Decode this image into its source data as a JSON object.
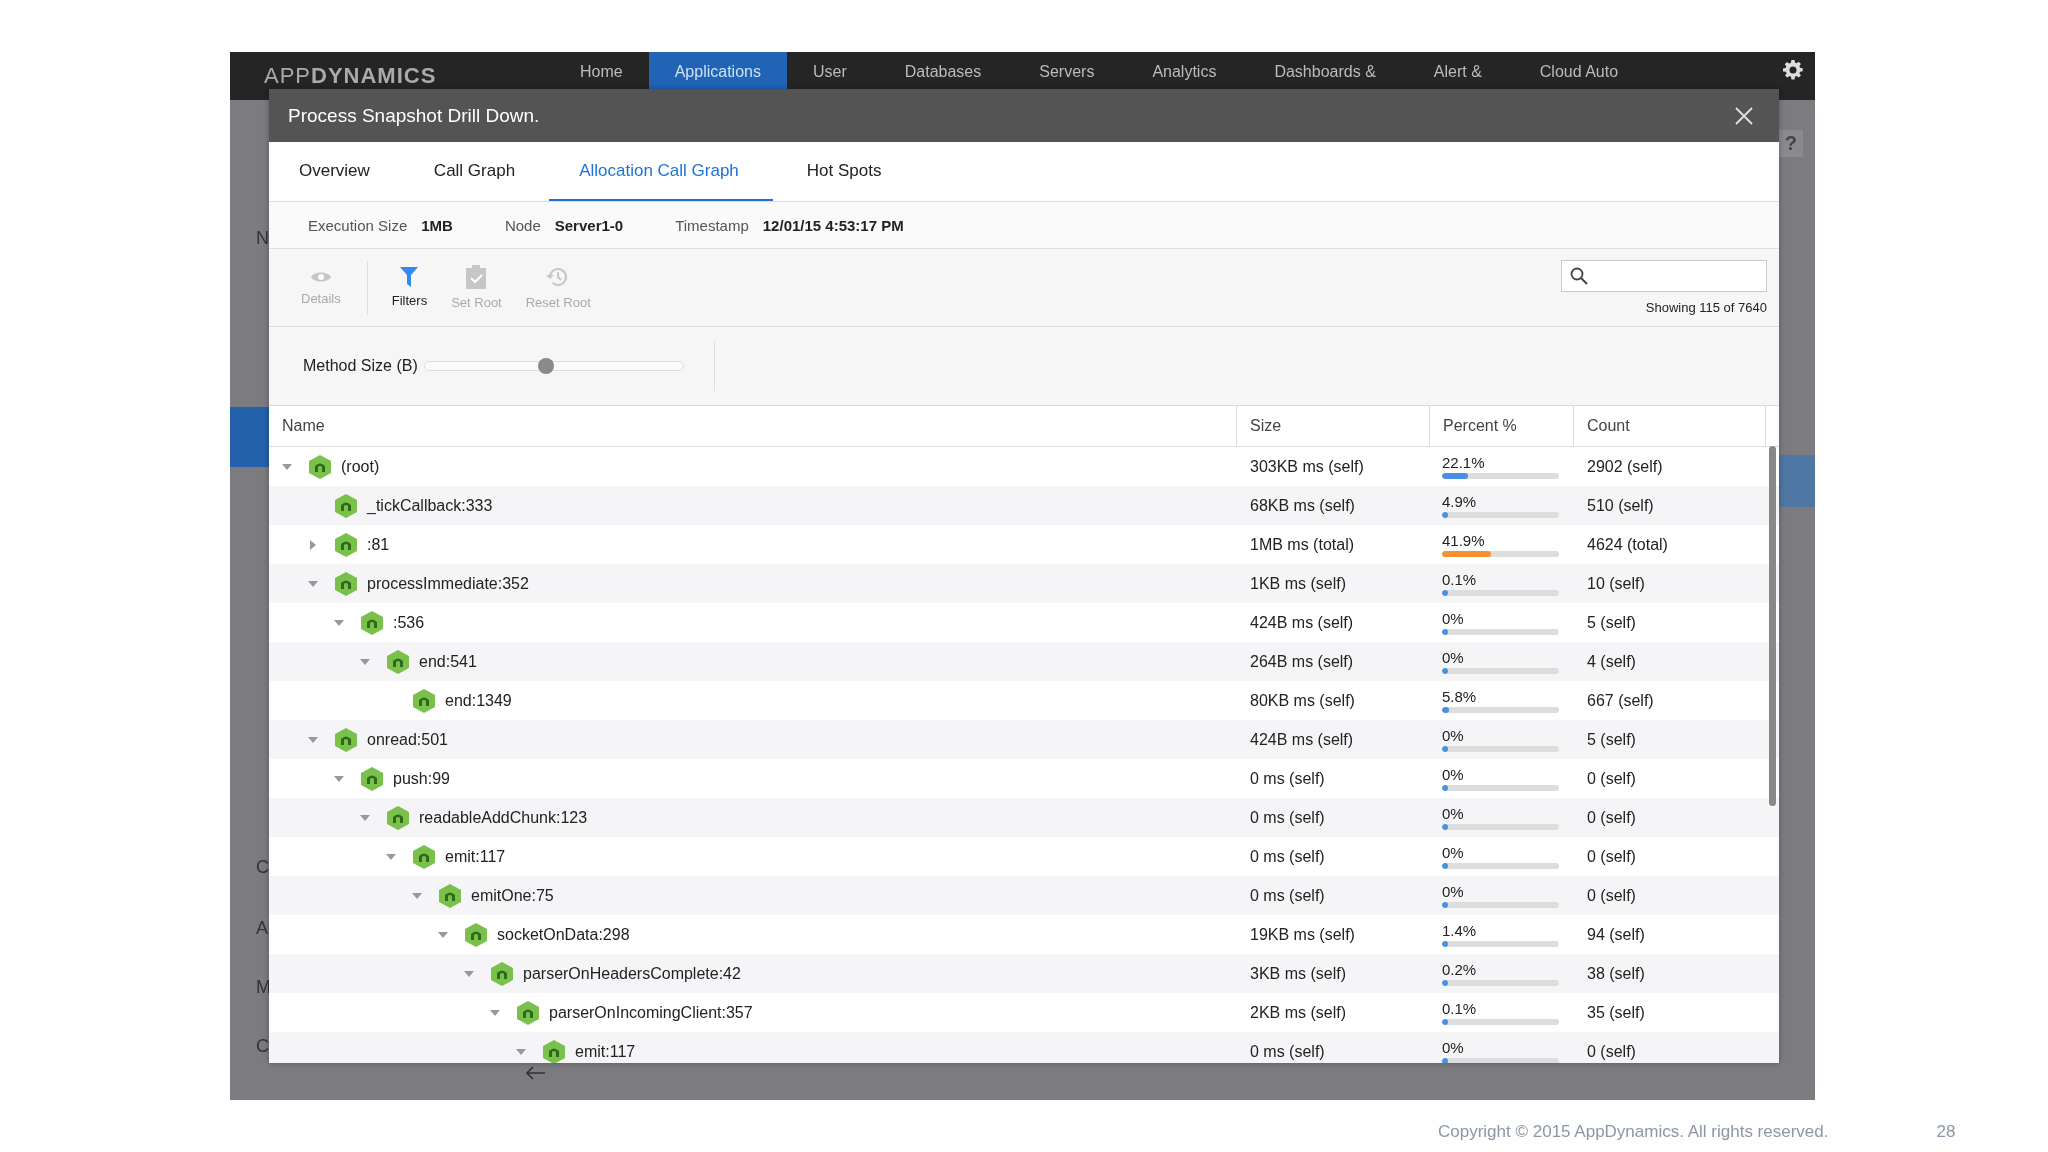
{
  "app": {
    "logo": "APP**DYNAMICS**",
    "nav": [
      {
        "label": "Home",
        "selected": false
      },
      {
        "label": "Applications",
        "selected": true
      },
      {
        "label": "User",
        "selected": false
      },
      {
        "label": "Databases",
        "selected": false
      },
      {
        "label": "Servers",
        "selected": false
      },
      {
        "label": "Analytics",
        "selected": false
      },
      {
        "label": "Dashboards &",
        "selected": false
      },
      {
        "label": "Alert &",
        "selected": false
      },
      {
        "label": "Cloud Auto",
        "selected": false
      }
    ],
    "sidebar_peek": [
      "N",
      "C",
      "A",
      "M",
      "C"
    ],
    "help": "?"
  },
  "dialog": {
    "title": "Process Snapshot Drill Down.",
    "tabs": [
      {
        "label": "Overview",
        "selected": false
      },
      {
        "label": "Call Graph",
        "selected": false
      },
      {
        "label": "Allocation Call Graph",
        "selected": true
      },
      {
        "label": "Hot Spots",
        "selected": false
      }
    ],
    "info": [
      {
        "label": "Execution Size",
        "value": "1MB"
      },
      {
        "label": "Node",
        "value": "Server1-0"
      },
      {
        "label": "Timestamp",
        "value": "12/01/15 4:53:17 PM"
      }
    ],
    "toolbar": [
      {
        "kind": "eye",
        "label": "Details",
        "disabled": true
      },
      {
        "kind": "funnel",
        "label": "Filters",
        "disabled": false
      },
      {
        "kind": "clipboard",
        "label": "Set Root",
        "disabled": true
      },
      {
        "kind": "history",
        "label": "Reset Root",
        "disabled": true
      }
    ],
    "search": {
      "count": "Showing 115 of 7640"
    },
    "slider": {
      "label": "Method Size (B)",
      "level": 0.47
    },
    "columns": [
      "Name",
      "Size",
      "Percent %",
      "Count"
    ],
    "tree": [
      {
        "name": "(root)",
        "size": "303KB ms (self)",
        "percent": "22.1%",
        "level": 0.221,
        "color": "#4a90e2",
        "count": "2902 (self)",
        "expanded": true,
        "children": [
          {
            "name": "_tickCallback:333",
            "size": "68KB ms (self)",
            "percent": "4.9%",
            "level": 0.049,
            "color": "#4a90e2",
            "count": "510 (self)"
          },
          {
            "name": ":81",
            "size": "1MB ms (total)",
            "percent": "41.9%",
            "level": 0.419,
            "color": "#f5922f",
            "count": "4624 (total)",
            "expanded": false
          },
          {
            "name": "processImmediate:352",
            "size": "1KB ms (self)",
            "percent": "0.1%",
            "level": 0.001,
            "color": "#4a90e2",
            "count": "10 (self)",
            "expanded": true,
            "children": [
              {
                "name": ":536",
                "size": "424B ms (self)",
                "percent": "0%",
                "level": 0,
                "color": "#4a90e2",
                "count": "5 (self)",
                "expanded": true,
                "children": [
                  {
                    "name": "end:541",
                    "size": "264B ms (self)",
                    "percent": "0%",
                    "level": 0,
                    "color": "#4a90e2",
                    "count": "4 (self)",
                    "expanded": true,
                    "children": [
                      {
                        "name": "end:1349",
                        "size": "80KB ms (self)",
                        "percent": "5.8%",
                        "level": 0.058,
                        "color": "#4a90e2",
                        "count": "667 (self)"
                      }
                    ]
                  }
                ]
              }
            ]
          },
          {
            "name": "onread:501",
            "size": "424B ms (self)",
            "percent": "0%",
            "level": 0,
            "color": "#4a90e2",
            "count": "5 (self)",
            "expanded": true,
            "children": [
              {
                "name": "push:99",
                "size": "0 ms (self)",
                "percent": "0%",
                "level": 0,
                "color": "#4a90e2",
                "count": "0 (self)",
                "expanded": true,
                "children": [
                  {
                    "name": "readableAddChunk:123",
                    "size": "0 ms (self)",
                    "percent": "0%",
                    "level": 0,
                    "color": "#4a90e2",
                    "count": "0 (self)",
                    "expanded": true,
                    "children": [
                      {
                        "name": "emit:117",
                        "size": "0 ms (self)",
                        "percent": "0%",
                        "level": 0,
                        "color": "#4a90e2",
                        "count": "0 (self)",
                        "expanded": true,
                        "children": [
                          {
                            "name": "emitOne:75",
                            "size": "0 ms (self)",
                            "percent": "0%",
                            "level": 0,
                            "color": "#4a90e2",
                            "count": "0 (self)",
                            "expanded": true,
                            "children": [
                              {
                                "name": "socketOnData:298",
                                "size": "19KB ms (self)",
                                "percent": "1.4%",
                                "level": 0.014,
                                "color": "#4a90e2",
                                "count": "94 (self)",
                                "expanded": true,
                                "children": [
                                  {
                                    "name": "parserOnHeadersComplete:42",
                                    "size": "3KB ms (self)",
                                    "percent": "0.2%",
                                    "level": 0.002,
                                    "color": "#4a90e2",
                                    "count": "38 (self)",
                                    "expanded": true,
                                    "children": [
                                      {
                                        "name": "parserOnIncomingClient:357",
                                        "size": "2KB ms (self)",
                                        "percent": "0.1%",
                                        "level": 0.001,
                                        "color": "#4a90e2",
                                        "count": "35 (self)",
                                        "expanded": true,
                                        "children": [
                                          {
                                            "name": "emit:117",
                                            "size": "0 ms (self)",
                                            "percent": "0%",
                                            "level": 0,
                                            "color": "#4a90e2",
                                            "count": "0 (self)",
                                            "expanded": true
                                          }
                                        ]
                                      }
                                    ]
                                  }
                                ]
                              }
                            ]
                          }
                        ]
                      }
                    ]
                  }
                ]
              }
            ]
          }
        ]
      }
    ]
  },
  "footer": {
    "copyright": "Copyright © 2015 AppDynamics. All rights reserved.",
    "page": "28"
  }
}
